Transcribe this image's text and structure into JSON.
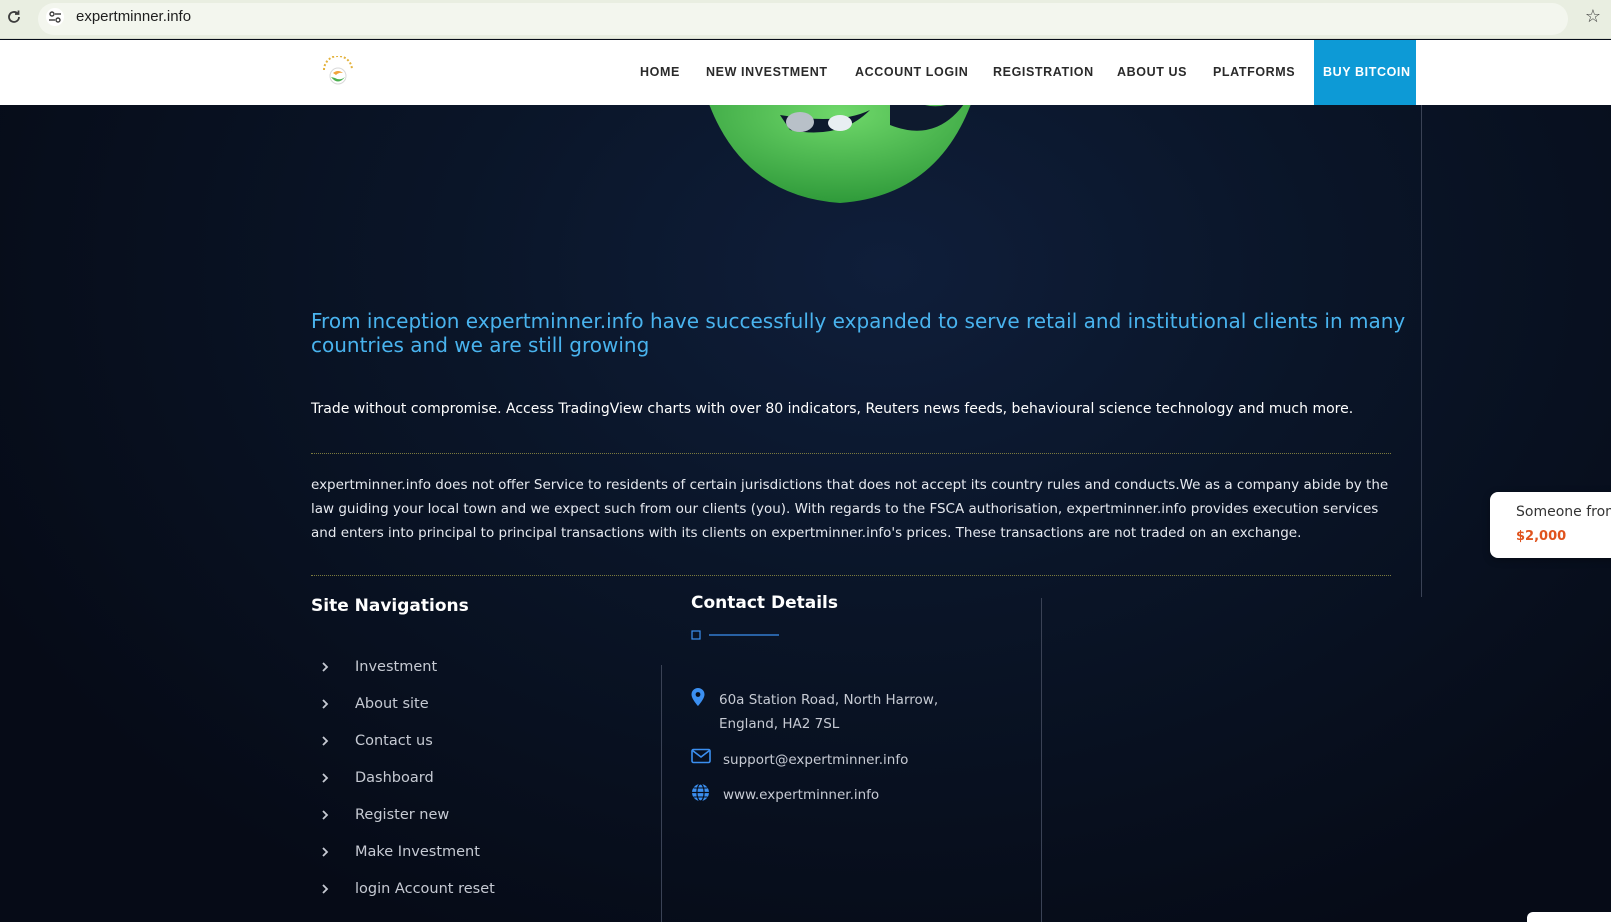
{
  "browser": {
    "url": "expertminner.info"
  },
  "header": {
    "nav": [
      {
        "label": "HOME"
      },
      {
        "label": "NEW INVESTMENT"
      },
      {
        "label": "ACCOUNT LOGIN"
      },
      {
        "label": "REGISTRATION"
      },
      {
        "label": "ABOUT US"
      },
      {
        "label": "PLATFORMS"
      },
      {
        "label": "BUY BITCOIN"
      }
    ],
    "accent_color": "#0d9ad6"
  },
  "main": {
    "headline": "From inception expertminner.info have successfully expanded to serve retail and institutional clients in many countries and we are still growing",
    "tagline": "Trade without compromise. Access TradingView charts with over 80 indicators, Reuters news feeds, behavioural science technology and much more.",
    "disclaimer": "expertminner.info does not offer Service to residents of certain jurisdictions that does not accept its country rules and conducts.We as a company abide by the law guiding your local town and we expect such from our clients (you). With regards to the FSCA authorisation, expertminner.info provides execution services and enters into principal to principal transactions with its clients on expertminner.info's prices. These transactions are not traded on an exchange."
  },
  "site_nav": {
    "title": "Site Navigations",
    "items": [
      {
        "label": "Investment"
      },
      {
        "label": "About site"
      },
      {
        "label": "Contact us"
      },
      {
        "label": "Dashboard"
      },
      {
        "label": "Register new"
      },
      {
        "label": "Make Investment"
      },
      {
        "label": "login Account reset"
      }
    ]
  },
  "contact": {
    "title": "Contact Details",
    "address_line1": "60a Station Road, North Harrow,",
    "address_line2": "England, HA2 7SL",
    "email": "support@expertminner.info",
    "website": "www.expertminner.info",
    "icon_color": "#3b8ff0"
  },
  "toast": {
    "text": "Someone from",
    "amount": "$2,000"
  }
}
